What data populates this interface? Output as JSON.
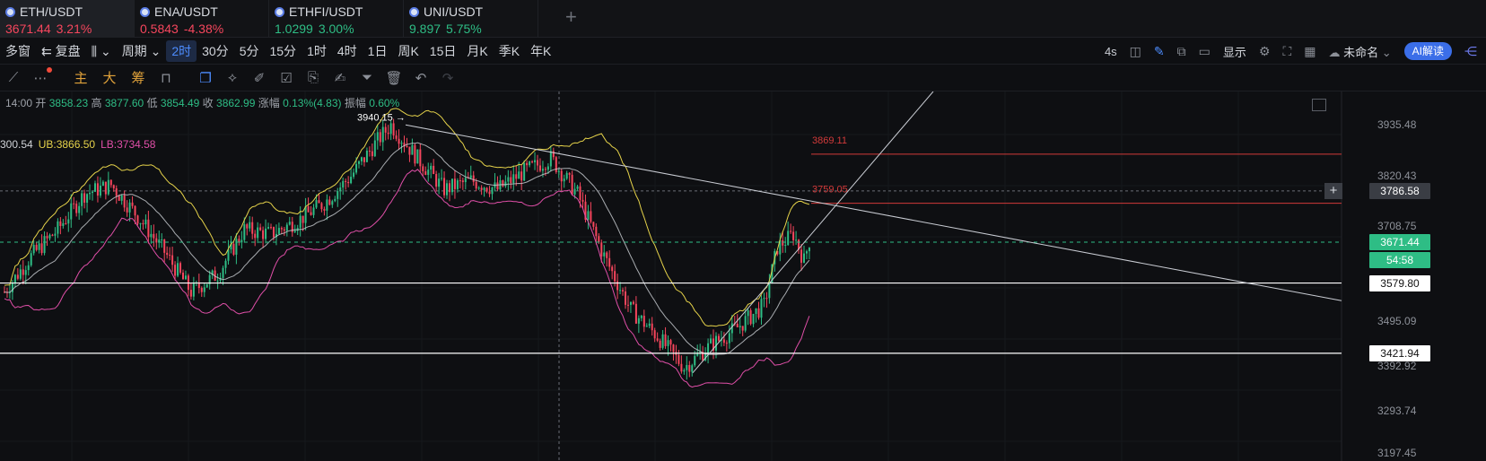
{
  "tabs": [
    {
      "symbol": "ETH/USDT",
      "price": "3671.44",
      "change": "3.21%",
      "dir": "down",
      "active": true
    },
    {
      "symbol": "ENA/USDT",
      "price": "0.5843",
      "change": "-4.38%",
      "dir": "down",
      "active": false
    },
    {
      "symbol": "ETHFI/USDT",
      "price": "1.0299",
      "change": "3.00%",
      "dir": "up",
      "active": false
    },
    {
      "symbol": "UNI/USDT",
      "price": "9.897",
      "change": "5.75%",
      "dir": "up",
      "active": false
    }
  ],
  "toolbar": {
    "multi_window": "多窗",
    "replay": "复盘",
    "period": "周期",
    "intervals": [
      "2时",
      "30分",
      "5分",
      "15分",
      "1时",
      "4时",
      "1日",
      "周K",
      "15日",
      "月K",
      "季K",
      "年K"
    ],
    "active_interval": "2时",
    "countdown": "4s",
    "display": "显示",
    "workspace": "未命名",
    "ai_button": "AI解读"
  },
  "tools": {
    "indicators": [
      "主",
      "大",
      "筹"
    ]
  },
  "ohlc": {
    "time": "14:00",
    "open_label": "开",
    "open": "3858.23",
    "high_label": "高",
    "high": "3877.60",
    "low_label": "低",
    "low": "3854.49",
    "close_label": "收",
    "close": "3862.99",
    "change_label": "涨幅",
    "change": "0.13%(4.83)",
    "amp_label": "振幅",
    "amp": "0.60%"
  },
  "bollinger": {
    "mid": "300.54",
    "ub": "UB:3866.50",
    "lb": "LB:3734.58"
  },
  "price_axis": {
    "ticks": [
      "3935.48",
      "3820.43",
      "3708.75",
      "3495.09",
      "3392.92",
      "3293.74",
      "3197.45"
    ],
    "tick_values": [
      3935.48,
      3820.43,
      3708.75,
      3495.09,
      3392.92,
      3293.74,
      3197.45
    ],
    "crosshair_price": "3786.58",
    "current_price": "3671.44",
    "countdown": "54:58",
    "level_high": "3579.80",
    "level_low": "3421.94"
  },
  "annotations": {
    "peak": "3940.15 →",
    "line_a": "3869.11",
    "line_b": "3759.05"
  },
  "colors": {
    "up": "#2ebd85",
    "down": "#f6465d",
    "ub": "#e5d24a",
    "lb": "#e04fa8",
    "mid": "#d0d3d8"
  },
  "chart_data": {
    "type": "candlestick",
    "ylim": [
      3180,
      4010
    ],
    "keypoints": [
      [
        0,
        3560
      ],
      [
        10,
        3640
      ],
      [
        20,
        3700
      ],
      [
        30,
        3780
      ],
      [
        40,
        3800
      ],
      [
        50,
        3730
      ],
      [
        60,
        3650
      ],
      [
        70,
        3560
      ],
      [
        80,
        3600
      ],
      [
        90,
        3700
      ],
      [
        100,
        3690
      ],
      [
        110,
        3720
      ],
      [
        120,
        3760
      ],
      [
        130,
        3820
      ],
      [
        140,
        3900
      ],
      [
        145,
        3935
      ],
      [
        155,
        3860
      ],
      [
        165,
        3790
      ],
      [
        175,
        3810
      ],
      [
        185,
        3790
      ],
      [
        195,
        3830
      ],
      [
        205,
        3860
      ],
      [
        215,
        3780
      ],
      [
        225,
        3640
      ],
      [
        235,
        3520
      ],
      [
        245,
        3460
      ],
      [
        255,
        3390
      ],
      [
        265,
        3440
      ],
      [
        275,
        3480
      ],
      [
        285,
        3530
      ],
      [
        290,
        3660
      ],
      [
        296,
        3690
      ],
      [
        300,
        3630
      ],
      [
        302,
        3675
      ]
    ]
  }
}
